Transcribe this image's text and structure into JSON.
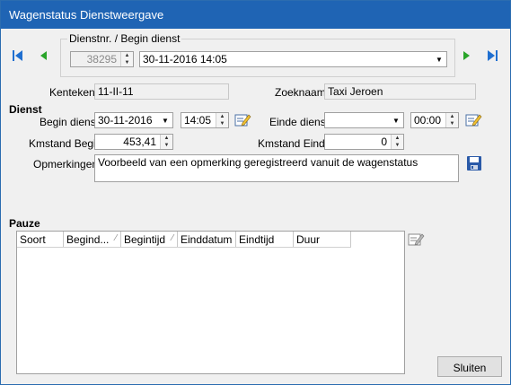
{
  "window": {
    "title": "Wagenstatus Dienstweergave"
  },
  "navigation": {
    "first_icon": "first-record-icon",
    "prev_icon": "prev-record-icon",
    "next_icon": "next-record-icon",
    "last_icon": "last-record-icon",
    "group_label": "Dienstnr. / Begin dienst",
    "dienstnr": "38295",
    "begin_dienst_combo": "30-11-2016 14:05"
  },
  "vehicle": {
    "kenteken_label": "Kenteken",
    "kenteken_value": "11-II-11",
    "zoeknaam_label": "Zoeknaam",
    "zoeknaam_value": "Taxi Jeroen"
  },
  "dienst": {
    "section_label": "Dienst",
    "begin_label": "Begin dienst",
    "begin_date": "30-11-2016",
    "begin_time": "14:05",
    "einde_label": "Einde dienst",
    "einde_date": "",
    "einde_time": "00:00",
    "km_begin_label": "Kmstand Begin",
    "km_begin_value": "453,41",
    "km_einde_label": "Kmstand Einde",
    "km_einde_value": "0",
    "opmerkingen_label": "Opmerkingen",
    "opmerkingen_value": "Voorbeeld van een opmerking geregistreerd vanuit de wagenstatus"
  },
  "pauze": {
    "section_label": "Pauze",
    "columns": [
      "Soort",
      "Begind...",
      "Begintijd",
      "Einddatum",
      "Eindtijd",
      "Duur"
    ],
    "rows": []
  },
  "buttons": {
    "close_label": "Sluiten"
  },
  "colors": {
    "title_bar": "#1f64b4",
    "window_bg": "#f0f0f0",
    "nav_green": "#2aa52a",
    "nav_blue": "#1f6fd0"
  }
}
